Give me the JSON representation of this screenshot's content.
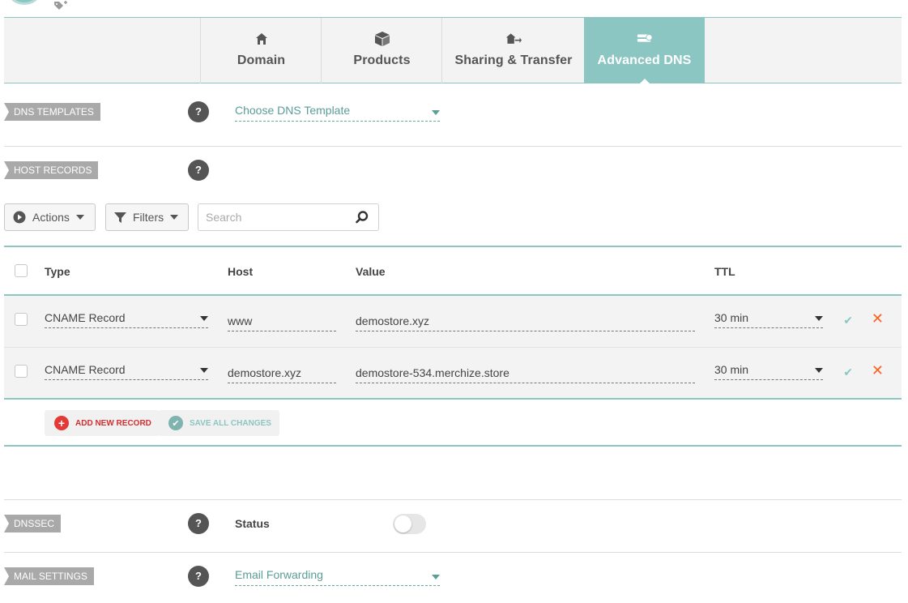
{
  "tabs": [
    {
      "label": "Domain",
      "icon": "home-icon",
      "active": false
    },
    {
      "label": "Products",
      "icon": "box-icon",
      "active": false
    },
    {
      "label": "Sharing & Transfer",
      "icon": "share-house-icon",
      "active": false
    },
    {
      "label": "Advanced DNS",
      "icon": "server-dns-icon",
      "active": true
    }
  ],
  "sections": {
    "dns_templates": {
      "label": "DNS TEMPLATES",
      "select_value": "Choose DNS Template"
    },
    "host_records": {
      "label": "HOST RECORDS"
    },
    "dnssec": {
      "label": "DNSSEC",
      "status_label": "Status",
      "enabled": false
    },
    "mail_settings": {
      "label": "MAIL SETTINGS",
      "select_value": "Email Forwarding"
    }
  },
  "help_glyph": "?",
  "toolbar": {
    "actions_label": "Actions",
    "filters_label": "Filters",
    "search_placeholder": "Search"
  },
  "table": {
    "headers": {
      "type": "Type",
      "host": "Host",
      "value": "Value",
      "ttl": "TTL"
    },
    "rows": [
      {
        "type": "CNAME Record",
        "host": "www",
        "value": "demostore.xyz",
        "ttl": "30 min"
      },
      {
        "type": "CNAME Record",
        "host": "demostore.xyz",
        "value": "demostore-534.merchize.store",
        "ttl": "30 min"
      }
    ]
  },
  "buttons": {
    "add_new_record": "ADD NEW RECORD",
    "save_all_changes": "SAVE ALL CHANGES"
  },
  "colors": {
    "accent": "#8cc6c3",
    "delete": "#ff5f1f",
    "add": "#e53935"
  }
}
